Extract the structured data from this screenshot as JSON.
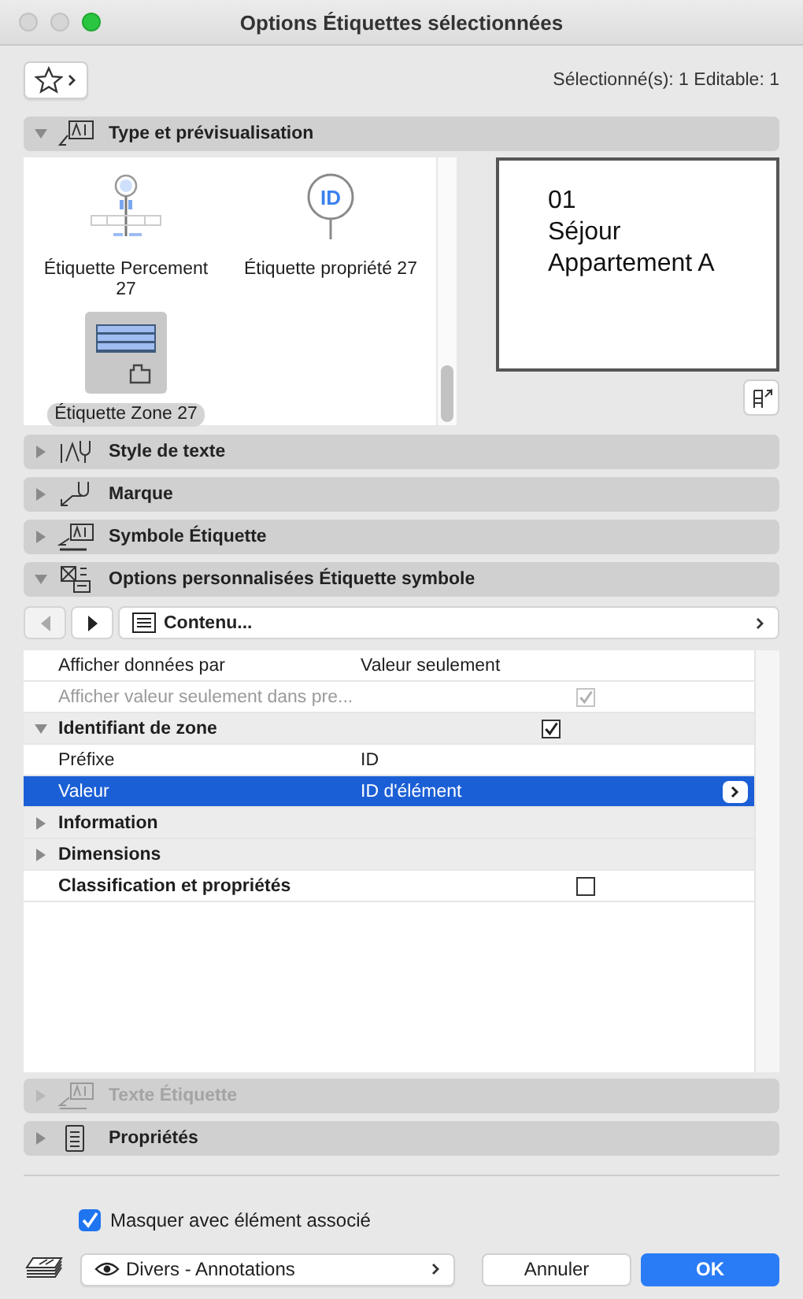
{
  "window": {
    "title": "Options Étiquettes sélectionnées"
  },
  "toolbar": {
    "selection_info": "Sélectionné(s): 1 Editable: 1"
  },
  "panels": [
    {
      "kind": "preview",
      "title": "Type et prévisualisation",
      "expanded": true,
      "disabled": false
    },
    {
      "kind": "textstyle",
      "title": "Style de texte",
      "expanded": false,
      "disabled": false
    },
    {
      "kind": "marker",
      "title": "Marque",
      "expanded": false,
      "disabled": false
    },
    {
      "kind": "symbol",
      "title": "Symbole Étiquette",
      "expanded": false,
      "disabled": false
    },
    {
      "kind": "custom",
      "title": "Options personnalisées Étiquette symbole",
      "expanded": true,
      "disabled": false
    },
    {
      "kind": "labeltext",
      "title": "Texte Étiquette",
      "expanded": false,
      "disabled": true
    },
    {
      "kind": "properties",
      "title": "Propriétés",
      "expanded": false,
      "disabled": false
    }
  ],
  "gallery": [
    {
      "kind": "opening",
      "label": "Étiquette Percement 27",
      "selected": false
    },
    {
      "kind": "property",
      "label": "Étiquette propriété 27",
      "badge": "ID",
      "selected": false
    },
    {
      "kind": "zone",
      "label": "Étiquette Zone 27",
      "selected": true
    }
  ],
  "preview": {
    "lines": [
      "01",
      "Séjour",
      "Appartement A"
    ]
  },
  "content_nav": {
    "back_disabled": true,
    "forward_disabled": false,
    "page": "Contenu..."
  },
  "table": {
    "rows": [
      {
        "kind": "value",
        "label": "Afficher données par",
        "value": "Valeur seulement",
        "selected": false
      },
      {
        "kind": "check",
        "label": "Afficher valeur seulement dans pre...",
        "checked": true,
        "disabled": true,
        "selected": false
      },
      {
        "kind": "group",
        "label": "Identifiant de zone",
        "expanded": true,
        "checked": true,
        "selected": false
      },
      {
        "kind": "value",
        "label": "Préfixe",
        "value": "ID",
        "selected": false
      },
      {
        "kind": "value",
        "label": "Valeur",
        "value": "ID d'élément",
        "selected": true
      },
      {
        "kind": "group",
        "label": "Information",
        "expanded": false,
        "selected": false
      },
      {
        "kind": "group",
        "label": "Dimensions",
        "expanded": false,
        "selected": false
      },
      {
        "kind": "bold-check",
        "label": "Classification et propriétés",
        "checked": false,
        "selected": false
      }
    ]
  },
  "footer": {
    "hide_with_element": {
      "label": "Masquer avec élément associé",
      "checked": true
    },
    "layer": "Divers - Annotations",
    "buttons": [
      {
        "label": "Annuler",
        "kind": "cancel"
      },
      {
        "label": "OK",
        "kind": "default"
      }
    ]
  }
}
